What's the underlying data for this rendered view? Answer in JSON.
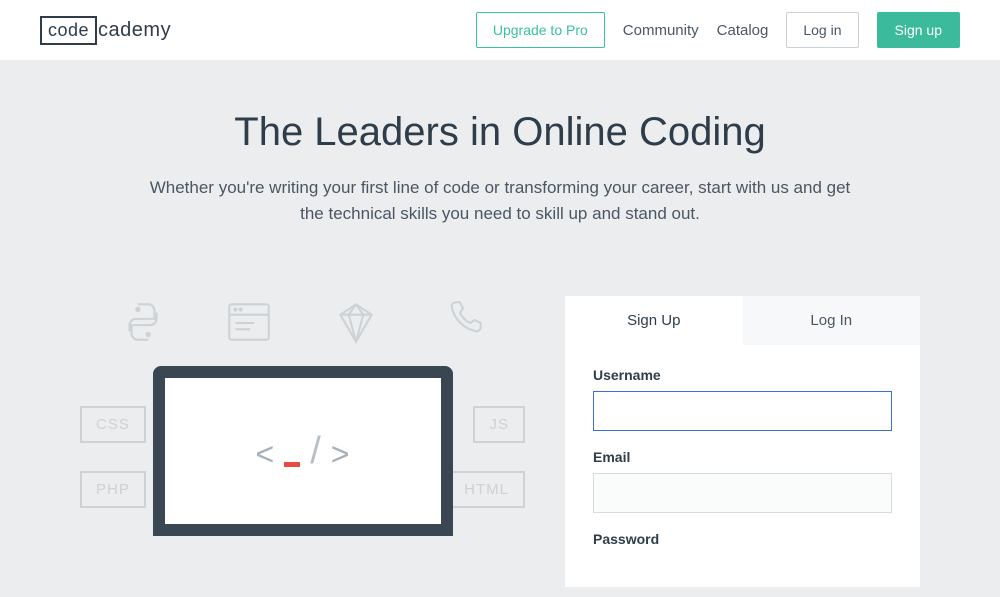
{
  "header": {
    "logo": {
      "box": "code",
      "rest": "cademy"
    },
    "nav": {
      "upgrade": "Upgrade to Pro",
      "community": "Community",
      "catalog": "Catalog",
      "login": "Log in",
      "signup": "Sign up"
    }
  },
  "hero": {
    "title": "The Leaders in Online Coding",
    "subtitle": "Whether you're writing your first line of code or transforming your career, start with us and get the technical skills you need to skill up and stand out."
  },
  "illustration": {
    "badges": {
      "css": "CSS",
      "js": "JS",
      "php": "PHP",
      "html": "HTML"
    },
    "face": {
      "lt": "<",
      "slash": "/",
      "gt": ">"
    }
  },
  "auth": {
    "tabs": {
      "signup": "Sign Up",
      "login": "Log In"
    },
    "fields": {
      "username": {
        "label": "Username",
        "value": ""
      },
      "email": {
        "label": "Email",
        "value": ""
      },
      "password": {
        "label": "Password",
        "value": ""
      }
    }
  }
}
